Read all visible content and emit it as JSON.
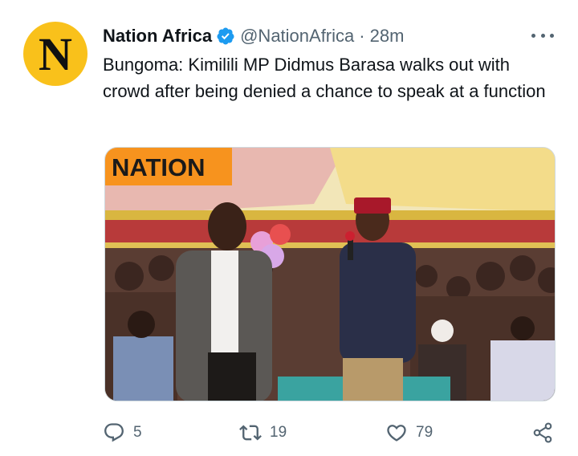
{
  "tweet": {
    "avatar_letter": "N",
    "author_name": "Nation Africa",
    "handle": "@NationAfrica",
    "separator": "·",
    "time": "28m",
    "text": "Bungoma: Kimilili MP Didmus Barasa walks out with crowd after being denied a chance to speak at a function",
    "media": {
      "watermark": "NATION"
    },
    "actions": {
      "replies": "5",
      "retweets": "19",
      "likes": "79"
    }
  },
  "colors": {
    "avatar_bg": "#f9c11b",
    "verified": "#1d9bf0",
    "secondary_text": "#536471",
    "watermark_bg": "#f7931e"
  },
  "icons": {
    "verified": "verified-badge-icon",
    "more": "more-options-icon",
    "reply": "reply-icon",
    "retweet": "retweet-icon",
    "like": "heart-icon",
    "share": "share-icon"
  }
}
